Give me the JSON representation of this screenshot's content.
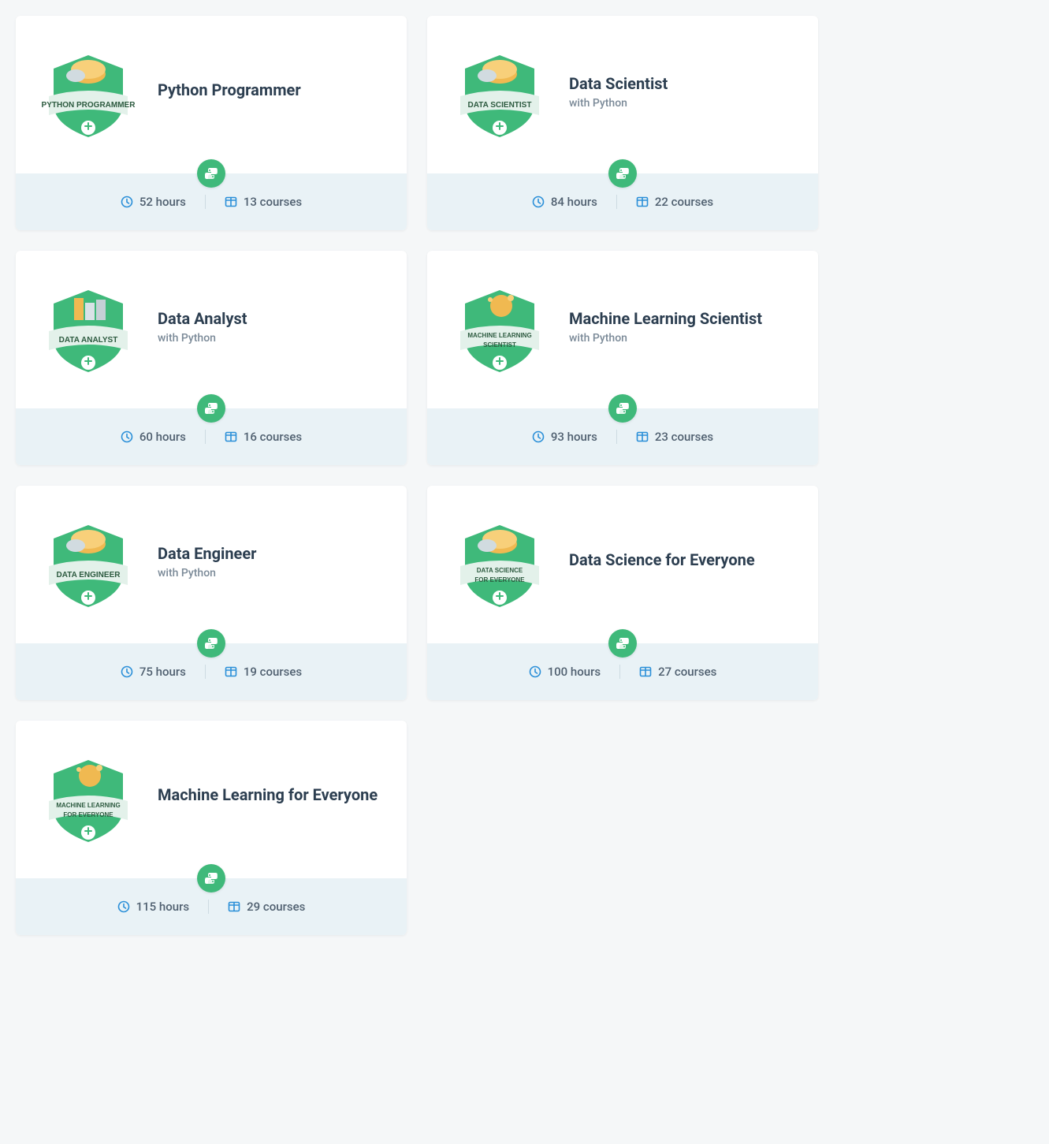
{
  "hours_suffix": "hours",
  "courses_suffix": "courses",
  "tracks": [
    {
      "title": "Python Programmer",
      "subtitle": "",
      "hours": "52",
      "courses": "13",
      "badge_label": "PYTHON PROGRAMMER",
      "tech_icon": "python-icon"
    },
    {
      "title": "Data Scientist",
      "subtitle": "with Python",
      "hours": "84",
      "courses": "22",
      "badge_label": "DATA SCIENTIST",
      "tech_icon": "python-icon"
    },
    {
      "title": "Data Analyst",
      "subtitle": "with Python",
      "hours": "60",
      "courses": "16",
      "badge_label": "DATA ANALYST",
      "tech_icon": "python-icon"
    },
    {
      "title": "Machine Learning Scientist",
      "subtitle": "with Python",
      "hours": "93",
      "courses": "23",
      "badge_label": "MACHINE LEARNING SCIENTIST",
      "tech_icon": "python-icon"
    },
    {
      "title": "Data Engineer",
      "subtitle": "with Python",
      "hours": "75",
      "courses": "19",
      "badge_label": "DATA ENGINEER",
      "tech_icon": "python-icon"
    },
    {
      "title": "Data Science for Everyone",
      "subtitle": "",
      "hours": "100",
      "courses": "27",
      "badge_label": "DATA SCIENCE FOR EVERYONE",
      "tech_icon": "python-icon"
    },
    {
      "title": "Machine Learning for Everyone",
      "subtitle": "",
      "hours": "115",
      "courses": "29",
      "badge_label": "MACHINE LEARNING FOR EVERYONE",
      "tech_icon": "python-icon"
    }
  ]
}
